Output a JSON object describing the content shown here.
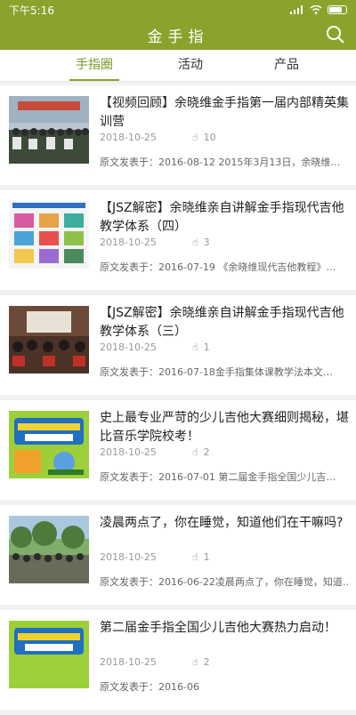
{
  "status": {
    "time": "下午5:16"
  },
  "header": {
    "title": "金手指"
  },
  "tabs": [
    {
      "label": "手指圈",
      "active": true
    },
    {
      "label": "活动",
      "active": false
    },
    {
      "label": "产品",
      "active": false
    }
  ],
  "articles": [
    {
      "title": "【视频回顾】余晓维金手指第一届内部精英集训营",
      "date": "2018-10-25",
      "views": "10",
      "excerpt": "原文发表于：2016-08-12  2015年3月13日，余晓维…",
      "thumb": "group-photo"
    },
    {
      "title": "【JSZ解密】余晓维亲自讲解金手指现代吉他教学体系（四）",
      "date": "2018-10-25",
      "views": "3",
      "excerpt": "原文发表于：2016-07-19 《余晓维现代吉他教程》…",
      "thumb": "book-grid"
    },
    {
      "title": "【JSZ解密】余晓维亲自讲解金手指现代吉他教学体系（三）",
      "date": "2018-10-25",
      "views": "1",
      "excerpt": "原文发表于：2016-07-18金手指集体课教学法本文…",
      "thumb": "classroom"
    },
    {
      "title": "史上最专业严苛的少儿吉他大赛细则揭秘，堪比音乐学院校考！",
      "date": "2018-10-25",
      "views": "2",
      "excerpt": "原文发表于：2016-07-01  第二届金手指全国少儿吉…",
      "thumb": "poster"
    },
    {
      "title": "凌晨两点了，你在睡觉，知道他们在干嘛吗?",
      "date": "2018-10-25",
      "views": "1",
      "excerpt": "原文发表于：2016-06-22凌晨两点了，你在睡觉，知道…",
      "thumb": "outdoor-group"
    },
    {
      "title": "第二届金手指全国少儿吉他大赛热力启动！",
      "date": "2018-10-25",
      "views": "2",
      "excerpt": "原文发表于：2016-06",
      "thumb": "poster"
    }
  ],
  "colors": {
    "accent": "#8aa32c",
    "active_tab": "#7b9628"
  },
  "icons": {
    "search": "search-icon",
    "views": "hand-pointer-icon"
  }
}
